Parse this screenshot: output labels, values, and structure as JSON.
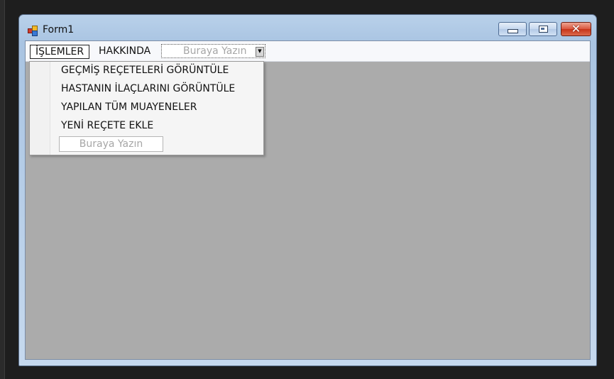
{
  "window": {
    "title": "Form1"
  },
  "menubar": {
    "items": [
      {
        "label": "İŞLEMLER"
      },
      {
        "label": "HAKKINDA"
      }
    ],
    "placeholder": "Buraya Yazın"
  },
  "dropdown": {
    "items": [
      {
        "label": "GEÇMİŞ REÇETELERİ GÖRÜNTÜLE"
      },
      {
        "label": "HASTANIN İLAÇLARINI GÖRÜNTÜLE"
      },
      {
        "label": "YAPILAN TÜM MUAYENELER"
      },
      {
        "label": "YENİ REÇETE EKLE"
      }
    ],
    "placeholder": "Buraya Yazın"
  },
  "icons": {
    "app": "app-icon",
    "minimize": "minimize-icon",
    "maximize": "maximize-icon",
    "close": "close-icon",
    "dropdown_arrow": "chevron-down-icon"
  },
  "colors": {
    "titlebar": "#b9d1ea",
    "client": "#ababab",
    "close_button": "#c73418"
  }
}
